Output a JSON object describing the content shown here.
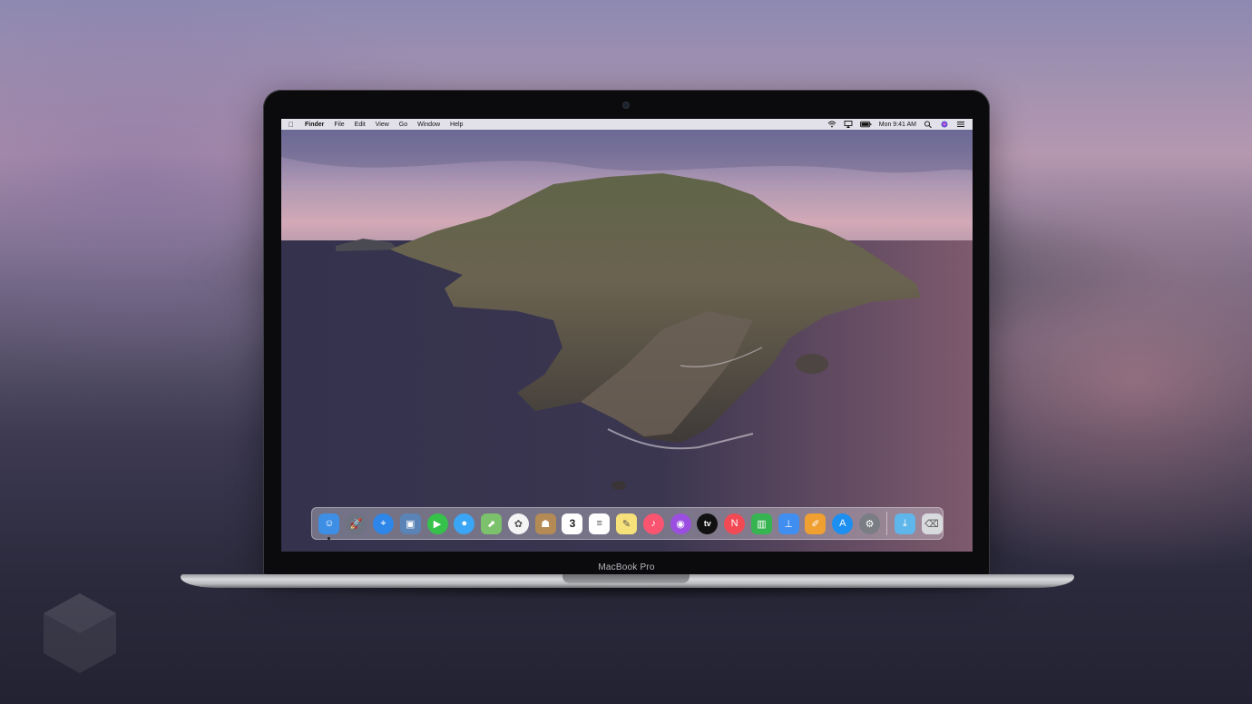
{
  "menubar": {
    "apple_icon": "apple-logo-icon",
    "app_name": "Finder",
    "menus": [
      "File",
      "Edit",
      "View",
      "Go",
      "Window",
      "Help"
    ],
    "clock": "Mon 9:41 AM",
    "status_icons": [
      "wifi-icon",
      "airplay-icon",
      "battery-icon",
      "search-icon",
      "siri-icon",
      "notification-center-icon"
    ]
  },
  "laptop": {
    "model_label": "MacBook Pro"
  },
  "dock": {
    "apps": [
      {
        "name": "Finder",
        "icon": "finder-icon",
        "color": "#3d8fe6"
      },
      {
        "name": "Launchpad",
        "icon": "launchpad-icon",
        "color": "#6d7380"
      },
      {
        "name": "Safari",
        "icon": "safari-icon",
        "color": "#2d86e8"
      },
      {
        "name": "Photo Booth",
        "icon": "photo-booth-icon",
        "color": "#5a83b6"
      },
      {
        "name": "FaceTime",
        "icon": "facetime-icon",
        "color": "#35c14a"
      },
      {
        "name": "Messages",
        "icon": "messages-icon",
        "color": "#3aa6f5"
      },
      {
        "name": "Maps",
        "icon": "maps-icon",
        "color": "#7cc16b"
      },
      {
        "name": "Photos",
        "icon": "photos-icon",
        "color": "#f4f4f4"
      },
      {
        "name": "Contacts",
        "icon": "contacts-icon",
        "color": "#b48a55"
      },
      {
        "name": "Calendar",
        "icon": "calendar-icon",
        "color": "#ffffff",
        "text": "3"
      },
      {
        "name": "Reminders",
        "icon": "reminders-icon",
        "color": "#ffffff"
      },
      {
        "name": "Notes",
        "icon": "notes-icon",
        "color": "#f7e17a"
      },
      {
        "name": "Music",
        "icon": "music-icon",
        "color": "#fb5470"
      },
      {
        "name": "Podcasts",
        "icon": "podcasts-icon",
        "color": "#9b4fe0"
      },
      {
        "name": "TV",
        "icon": "apple-tv-icon",
        "color": "#111111",
        "text": "tv"
      },
      {
        "name": "News",
        "icon": "news-icon",
        "color": "#f24a55"
      },
      {
        "name": "Numbers",
        "icon": "numbers-icon",
        "color": "#37b452"
      },
      {
        "name": "Keynote",
        "icon": "keynote-icon",
        "color": "#3f8ef0"
      },
      {
        "name": "Pages",
        "icon": "pages-icon",
        "color": "#f0a030"
      },
      {
        "name": "App Store",
        "icon": "app-store-icon",
        "color": "#1c8ff0"
      },
      {
        "name": "System Preferences",
        "icon": "system-preferences-icon",
        "color": "#7a7d84"
      }
    ],
    "trailing": [
      {
        "name": "Downloads",
        "icon": "downloads-folder-icon",
        "color": "#5fb6ea"
      },
      {
        "name": "Trash",
        "icon": "trash-icon",
        "color": "#d8dadd"
      }
    ]
  }
}
